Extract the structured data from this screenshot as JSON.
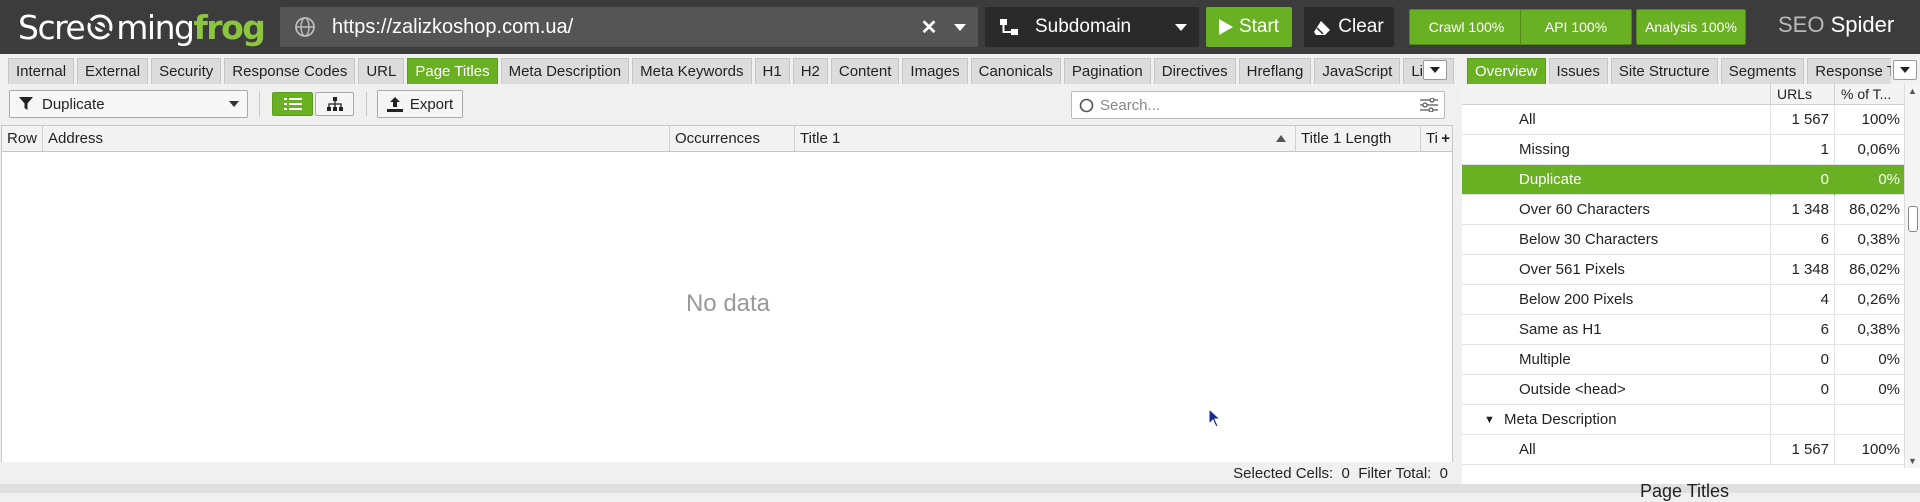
{
  "app": {
    "logo_left": "Scre",
    "logo_mid": "ming",
    "logo_frog": "frog",
    "url": "https://zalizkoshop.com.ua/",
    "mode": "Subdomain",
    "start_label": "Start",
    "clear_label": "Clear",
    "crawl_pill": "Crawl 100%",
    "api_pill": "API 100%",
    "analysis_pill": "Analysis 100%",
    "product_seo": "SEO",
    "product_spider": "Spider"
  },
  "main_tabs": [
    {
      "label": "Internal",
      "active": false
    },
    {
      "label": "External",
      "active": false
    },
    {
      "label": "Security",
      "active": false
    },
    {
      "label": "Response Codes",
      "active": false
    },
    {
      "label": "URL",
      "active": false
    },
    {
      "label": "Page Titles",
      "active": true
    },
    {
      "label": "Meta Description",
      "active": false
    },
    {
      "label": "Meta Keywords",
      "active": false
    },
    {
      "label": "H1",
      "active": false
    },
    {
      "label": "H2",
      "active": false
    },
    {
      "label": "Content",
      "active": false
    },
    {
      "label": "Images",
      "active": false
    },
    {
      "label": "Canonicals",
      "active": false
    },
    {
      "label": "Pagination",
      "active": false
    },
    {
      "label": "Directives",
      "active": false
    },
    {
      "label": "Hreflang",
      "active": false
    },
    {
      "label": "JavaScript",
      "active": false
    },
    {
      "label": "Links",
      "active": false
    }
  ],
  "right_tabs": [
    {
      "label": "Overview",
      "active": true
    },
    {
      "label": "Issues",
      "active": false
    },
    {
      "label": "Site Structure",
      "active": false
    },
    {
      "label": "Segments",
      "active": false
    },
    {
      "label": "Response T",
      "active": false
    }
  ],
  "toolbar": {
    "filter_value": "Duplicate",
    "export_label": "Export",
    "search_placeholder": "Search..."
  },
  "grid": {
    "columns": [
      "Row",
      "Address",
      "Occurrences",
      "Title 1",
      "Title 1 Length",
      "Ti"
    ],
    "empty_text": "No data"
  },
  "status": {
    "text": "Selected Cells:  0  Filter Total:  0"
  },
  "overview": {
    "columns": [
      "URLs",
      "% of T..."
    ],
    "rows": [
      {
        "name": "All",
        "urls": "1 567",
        "pct": "100%",
        "indent": 1,
        "selected": false
      },
      {
        "name": "Missing",
        "urls": "1",
        "pct": "0,06%",
        "indent": 1,
        "selected": false
      },
      {
        "name": "Duplicate",
        "urls": "0",
        "pct": "0%",
        "indent": 1,
        "selected": true
      },
      {
        "name": "Over 60 Characters",
        "urls": "1 348",
        "pct": "86,02%",
        "indent": 1,
        "selected": false
      },
      {
        "name": "Below 30 Characters",
        "urls": "6",
        "pct": "0,38%",
        "indent": 1,
        "selected": false
      },
      {
        "name": "Over 561 Pixels",
        "urls": "1 348",
        "pct": "86,02%",
        "indent": 1,
        "selected": false
      },
      {
        "name": "Below 200 Pixels",
        "urls": "4",
        "pct": "0,26%",
        "indent": 1,
        "selected": false
      },
      {
        "name": "Same as H1",
        "urls": "6",
        "pct": "0,38%",
        "indent": 1,
        "selected": false
      },
      {
        "name": "Multiple",
        "urls": "0",
        "pct": "0%",
        "indent": 1,
        "selected": false
      },
      {
        "name": "Outside <head>",
        "urls": "0",
        "pct": "0%",
        "indent": 1,
        "selected": false
      },
      {
        "name": "Meta Description",
        "urls": "",
        "pct": "",
        "indent": 0,
        "selected": false,
        "group": true
      },
      {
        "name": "All",
        "urls": "1 567",
        "pct": "100%",
        "indent": 1,
        "selected": false
      }
    ],
    "footer_peek": "Page Titles"
  },
  "colors": {
    "accent": "#6ab023",
    "topbar": "#3c3c3c"
  }
}
